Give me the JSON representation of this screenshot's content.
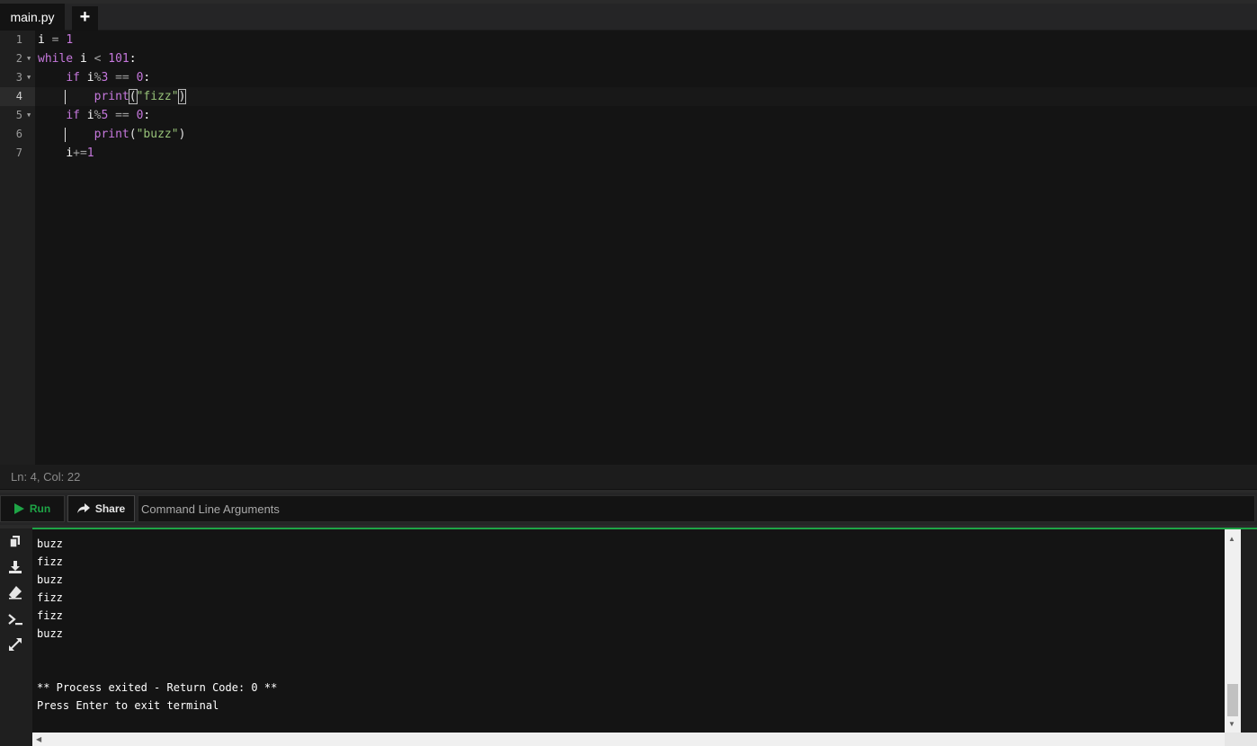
{
  "tabs": {
    "active": "main.py",
    "add_label": "+"
  },
  "editor": {
    "line_numbers": [
      "1",
      "2",
      "3",
      "4",
      "5",
      "6",
      "7"
    ],
    "code": {
      "l1": {
        "a": "i",
        "b": " = ",
        "c": "1"
      },
      "l2": {
        "a": "while",
        "b": " i ",
        "c": "<",
        "d": " ",
        "e": "101",
        "f": ":"
      },
      "l3": {
        "a": "    ",
        "b": "if",
        "c": " i",
        "d": "%",
        "e": "3",
        "f": " == ",
        "g": "0",
        "h": ":"
      },
      "l4": {
        "a": "        ",
        "b": "print",
        "c": "(",
        "d": "\"fizz\"",
        "e": ")"
      },
      "l5": {
        "a": "    ",
        "b": "if",
        "c": " i",
        "d": "%",
        "e": "5",
        "f": " == ",
        "g": "0",
        "h": ":"
      },
      "l6": {
        "a": "        ",
        "b": "print",
        "c": "(",
        "d": "\"buzz\"",
        "e": ")"
      },
      "l7": {
        "a": "    ",
        "b": "i",
        "c": "+=",
        "d": "1"
      }
    }
  },
  "status": {
    "text": "Ln: 4,  Col: 22"
  },
  "toolbar": {
    "run_label": "Run",
    "share_label": "Share",
    "args_placeholder": "Command Line Arguments"
  },
  "terminal": {
    "lines": [
      "buzz",
      "fizz",
      "buzz",
      "fizz",
      "fizz",
      "buzz",
      "",
      "",
      "** Process exited - Return Code: 0 **",
      "Press Enter to exit terminal"
    ]
  },
  "icons": {
    "sidebar": [
      "copy-icon",
      "download-icon",
      "eraser-icon",
      "terminal-prompt-icon",
      "expand-icon"
    ]
  },
  "colors": {
    "accent": "#1ea446",
    "keyword": "#c678dd",
    "string": "#98c379"
  }
}
